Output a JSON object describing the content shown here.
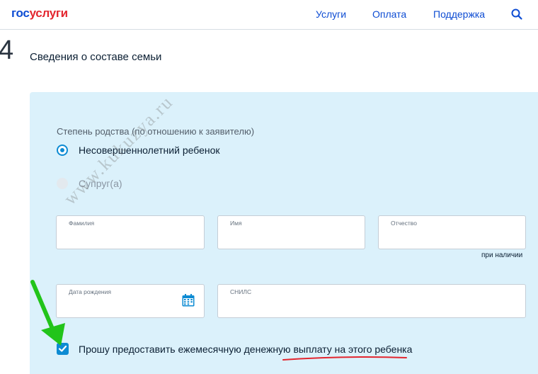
{
  "header": {
    "logo_part1": "гос",
    "logo_part2": "услуги",
    "nav": [
      "Услуги",
      "Оплата",
      "Поддержка"
    ],
    "search_icon": "search-icon"
  },
  "step": {
    "number": "4",
    "title": "Сведения о составе семьи"
  },
  "form": {
    "relation_label": "Степень родства (по отношению к заявителю)",
    "options": [
      {
        "label": "Несовершеннолетний ребенок",
        "selected": true
      },
      {
        "label": "Супруг(а)",
        "selected": false
      }
    ],
    "fields": {
      "last_name": "Фамилия",
      "first_name": "Имя",
      "middle_name": "Отчество",
      "birth_date": "Дата рождения",
      "snils": "СНИЛС"
    },
    "middle_name_hint": "при наличии",
    "checkbox_label": "Прошу предоставить ежемесячную денежную выплату на этого ребенка",
    "checkbox_checked": true
  },
  "watermark": "www.kukuzya.ru",
  "colors": {
    "brand_blue": "#0d4cd3",
    "brand_red": "#e3262f",
    "panel_bg": "#dbf1fb",
    "accent": "#0d8bd3",
    "annotation_green": "#22c41a",
    "annotation_red": "#e3262f"
  }
}
